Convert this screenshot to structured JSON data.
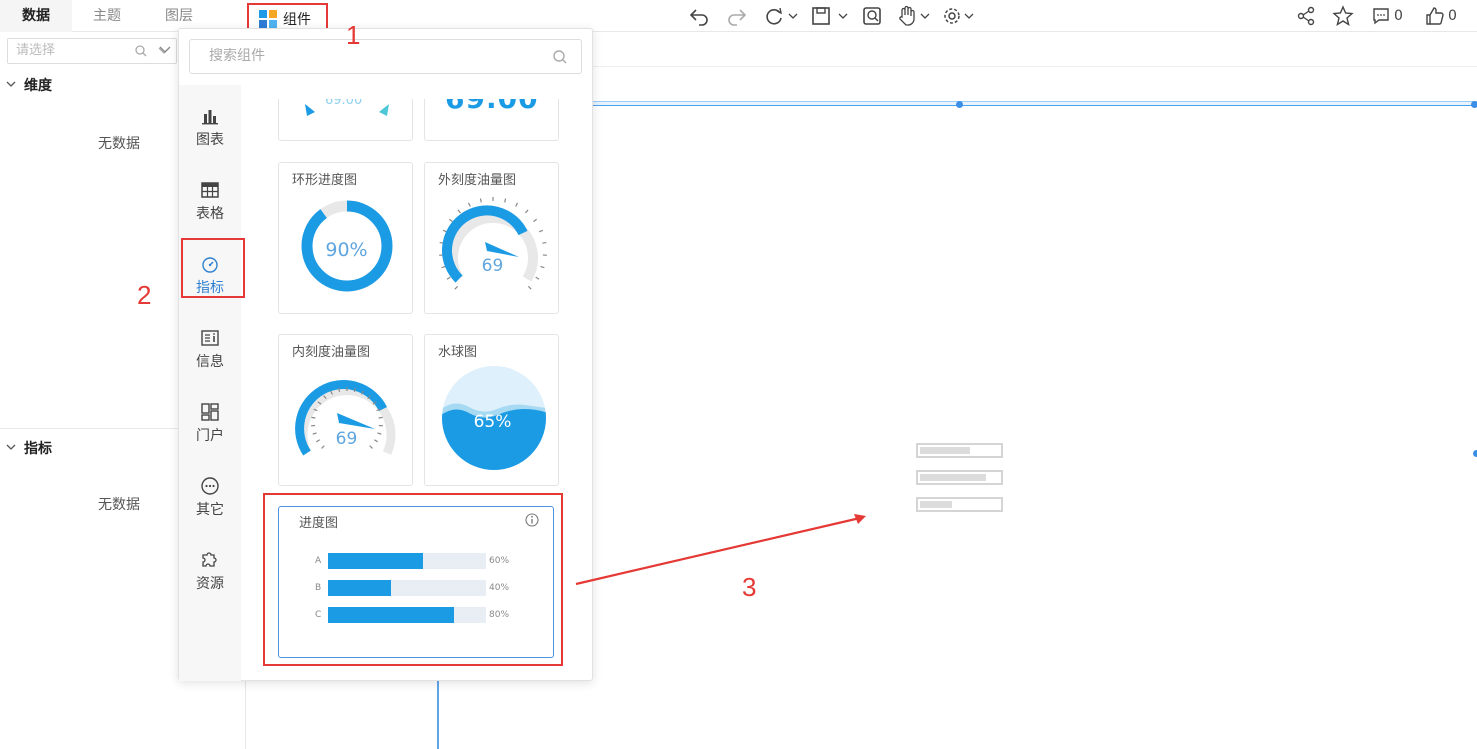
{
  "tabs": [
    {
      "label": "数据",
      "active": true
    },
    {
      "label": "主题",
      "active": false
    },
    {
      "label": "图层",
      "active": false
    }
  ],
  "component_button": {
    "label": "组件"
  },
  "toolbar_icons": [
    "undo-icon",
    "redo-icon",
    "refresh-icon",
    "save-icon",
    "preview-icon",
    "hand-icon",
    "gear-icon"
  ],
  "right_toolbar": {
    "comment_count": "0",
    "like_count": "0"
  },
  "left_panel": {
    "select_placeholder": "请选择",
    "dimension_title": "维度",
    "dimension_empty": "无数据",
    "measure_title": "指标",
    "measure_empty": "无数据"
  },
  "popup": {
    "search_placeholder": "搜索组件",
    "categories": [
      {
        "label": "图表",
        "icon": "bar-chart-icon",
        "active": false
      },
      {
        "label": "表格",
        "icon": "table-icon",
        "active": false
      },
      {
        "label": "指标",
        "icon": "gauge-icon",
        "active": true
      },
      {
        "label": "信息",
        "icon": "info-icon",
        "active": false
      },
      {
        "label": "门户",
        "icon": "portal-icon",
        "active": false
      },
      {
        "label": "其它",
        "icon": "more-icon",
        "active": false
      },
      {
        "label": "资源",
        "icon": "puzzle-icon",
        "active": false
      }
    ],
    "cards": [
      {
        "title": "",
        "value": "69.00"
      },
      {
        "title": "",
        "value": "69.00"
      },
      {
        "title": "环形进度图",
        "value": "90%"
      },
      {
        "title": "外刻度油量图",
        "value": "69"
      },
      {
        "title": "内刻度油量图",
        "value": "69"
      },
      {
        "title": "水球图",
        "value": "65%"
      }
    ],
    "progress_card": {
      "title": "进度图",
      "rows": [
        {
          "label": "A",
          "percent": 60,
          "text": "60%"
        },
        {
          "label": "B",
          "percent": 40,
          "text": "40%"
        },
        {
          "label": "C",
          "percent": 80,
          "text": "80%"
        }
      ]
    }
  },
  "annotations": [
    "1",
    "2",
    "3"
  ],
  "colors": {
    "accent": "#1c9be5",
    "annotation": "#e53935",
    "selected": "#2f80d1"
  }
}
